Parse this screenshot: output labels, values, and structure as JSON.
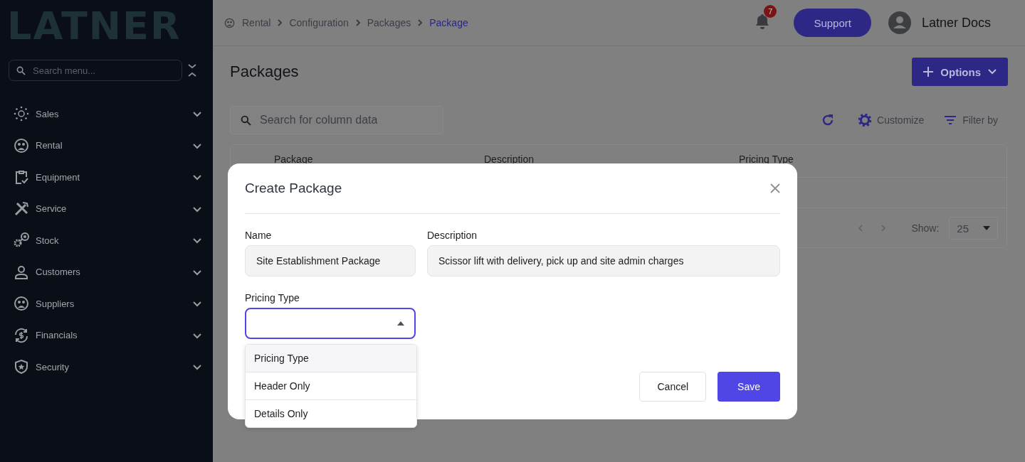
{
  "sidebar": {
    "logo": "LATNER",
    "search": {
      "placeholder": "Search menu..."
    },
    "items": [
      {
        "label": "Sales",
        "expanded": false
      },
      {
        "label": "Rental",
        "expanded": false
      },
      {
        "label": "Equipment",
        "expanded": false
      },
      {
        "label": "Service",
        "expanded": false
      },
      {
        "label": "Stock",
        "expanded": false
      },
      {
        "label": "Customers",
        "expanded": false
      },
      {
        "label": "Suppliers",
        "expanded": false
      },
      {
        "label": "Financials",
        "expanded": false
      },
      {
        "label": "Security",
        "expanded": false
      }
    ]
  },
  "breadcrumb": [
    {
      "label": "Rental",
      "current": false
    },
    {
      "label": "Configuration",
      "current": false
    },
    {
      "label": "Packages",
      "current": false
    },
    {
      "label": "Package",
      "current": true
    }
  ],
  "notifications": {
    "count": "7"
  },
  "support_button": "Support",
  "user": {
    "name": "Latner Docs"
  },
  "page": {
    "title": "Packages",
    "options_button": "Options",
    "search": {
      "placeholder": "Search for column data"
    },
    "toolbar": [
      "Customize",
      "Filter by"
    ],
    "table": {
      "columns": [
        "Package",
        "Description",
        "Pricing Type"
      ]
    },
    "pagination": {
      "show_label": "Show:",
      "page_size": "25"
    }
  },
  "modal": {
    "title": "Create Package",
    "fields": [
      {
        "label": "Name",
        "value": "Site Establishment Package"
      },
      {
        "label": "Description",
        "value": "Scissor lift with delivery, pick up and site admin charges"
      }
    ],
    "pricing_type": {
      "label": "Pricing Type",
      "expanded": true,
      "options": [
        {
          "label": "Pricing Type",
          "selected": true
        },
        {
          "label": "Header Only",
          "selected": false
        },
        {
          "label": "Details Only",
          "selected": false
        }
      ]
    },
    "buttons": [
      {
        "label": "Cancel",
        "kind": "secondary"
      },
      {
        "label": "Save",
        "kind": "primary"
      }
    ]
  }
}
